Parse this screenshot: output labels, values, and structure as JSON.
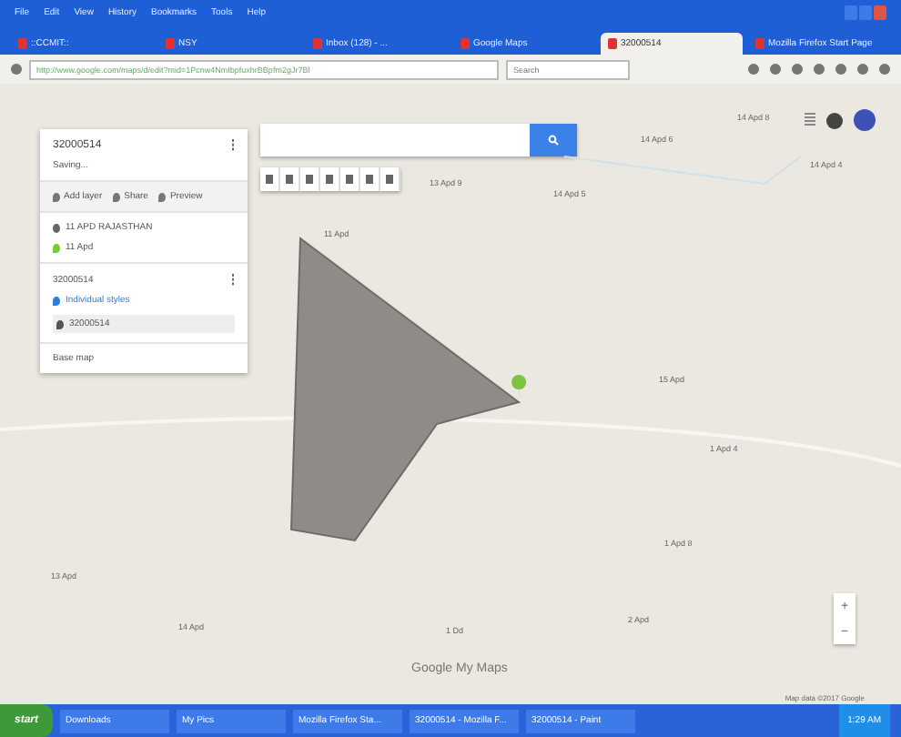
{
  "browser": {
    "menu": [
      "File",
      "Edit",
      "View",
      "History",
      "Bookmarks",
      "Tools",
      "Help"
    ],
    "tabs": [
      {
        "label": "::CCMIT::",
        "selected": false
      },
      {
        "label": "NSY",
        "selected": false
      },
      {
        "label": "Inbox (128) - ...",
        "selected": false
      },
      {
        "label": "Google Maps",
        "selected": false
      },
      {
        "label": "32000514",
        "selected": true
      },
      {
        "label": "Mozilla Firefox Start Page",
        "selected": false
      }
    ],
    "url": "http://www.google.com/maps/d/edit?mid=1Pcnw4NmIbpfuxhrBBpfm2gJr7Bl",
    "search_placeholder": "Search"
  },
  "panel": {
    "title": "32000514",
    "subtitle": "Saving...",
    "actions": [
      "Add layer",
      "Share",
      "Preview"
    ],
    "layers": [
      {
        "kind": "search",
        "title": "11 APD RAJASTHAN",
        "item": "11 Apd"
      },
      {
        "kind": "drawn",
        "title": "32000514",
        "style": "Individual styles",
        "item": "32000514"
      }
    ],
    "base_map": "Base map"
  },
  "map": {
    "labels": [
      "14 Apd 8",
      "14 Apd 6",
      "13 Apd 9",
      "14 Apd 5",
      "14 Apd 4",
      "11 Apd",
      "15 Apd",
      "1 Apd 4",
      "1 Apd 8",
      "2 Apd",
      "1 Dd",
      "13 Apd",
      "14 Apd"
    ],
    "zoom": [
      "+",
      "−"
    ],
    "footer": "Map data ©2017 Google",
    "brand": "Google My Maps"
  },
  "taskbar": {
    "start": "start",
    "items": [
      "Downloads",
      "My Pics",
      "Mozilla Firefox Sta...",
      "32000514 - Mozilla F...",
      "32000514 - Paint"
    ],
    "clock": "1:29 AM"
  }
}
